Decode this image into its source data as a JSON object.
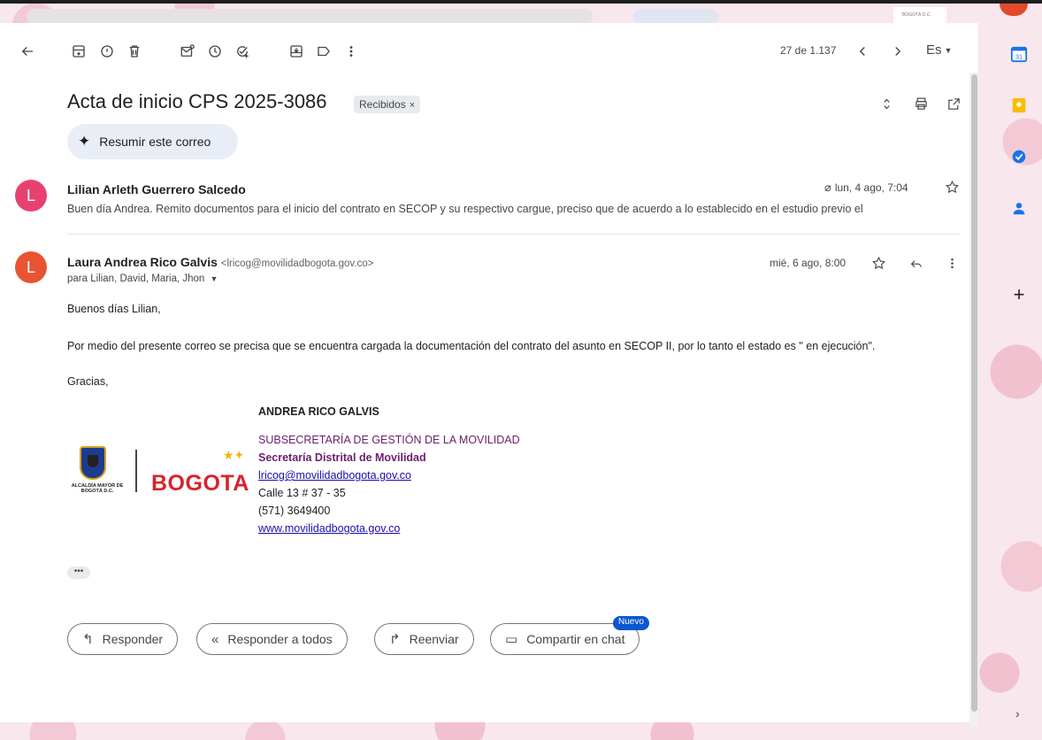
{
  "toolbar": {
    "pager": "27 de 1.137",
    "lang": "Es"
  },
  "topbar": {
    "logo_text": "BOGOTÁ D.C."
  },
  "thread": {
    "subject": "Acta de inicio CPS 2025-3086",
    "label": "Recibidos",
    "label_close": "×",
    "summarize": "Resumir este correo"
  },
  "message1": {
    "avatar_letter": "L",
    "avatar_color": "#e8416f",
    "sender": "Lilian Arleth Guerrero Salcedo",
    "date": "lun, 4 ago, 7:04",
    "snippet": "Buen día Andrea. Remito documentos para el inicio del contrato en SECOP y su respectivo cargue, preciso que de acuerdo a lo establecido en el estudio previo el"
  },
  "message2": {
    "avatar_letter": "L",
    "avatar_color": "#ea5331",
    "sender": "Laura Andrea Rico Galvis",
    "sender_email": "<lricog@movilidadbogota.gov.co>",
    "date": "mié, 6 ago, 8:00",
    "to": "para Lilian, David, Maria, Jhon",
    "greeting": "Buenos días Lilian,",
    "body": "Por medio del presente correo se precisa que se encuentra cargada la documentación del contrato del asunto en SECOP II, por lo tanto el estado es \" en ejecución\".",
    "closing": "Gracias,",
    "signature": {
      "name": "ANDREA RICO GALVIS",
      "dept": "SUBSECRETARÍA DE GESTIÓN DE LA MOVILIDAD",
      "org": "Secretaría Distrital de Movilidad",
      "email": "lricog@movilidadbogota.gov.co",
      "address": "Calle 13 # 37 - 35",
      "phone": "(571) 3649400",
      "web": "www.movilidadbogota.gov.co",
      "logo_alcaldia": "ALCALDÍA MAYOR DE BOGOTÁ D.C.",
      "logo_bogota": "BOGOTA"
    }
  },
  "actions": {
    "reply": "Responder",
    "reply_all": "Responder a todos",
    "forward": "Reenviar",
    "share_chat": "Compartir en chat",
    "new_badge": "Nuevo"
  },
  "colors": {
    "accent": "#0b57d0",
    "signature_purple": "#6b1f6e",
    "link": "#1a0dab",
    "bogota_red": "#d8232a"
  }
}
